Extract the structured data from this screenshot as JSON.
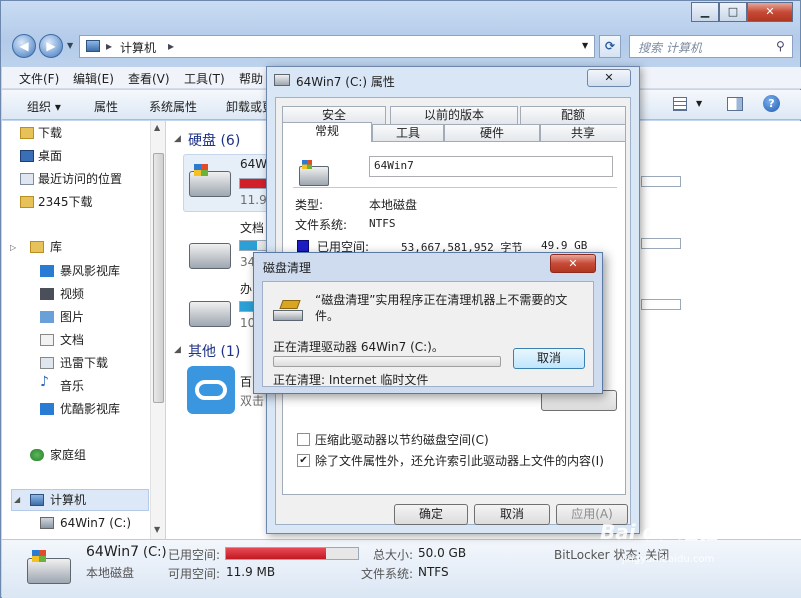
{
  "explorer": {
    "breadcrumb": [
      "计算机"
    ],
    "search_placeholder": "搜索 计算机",
    "menu": [
      "文件(F)",
      "编辑(E)",
      "查看(V)",
      "工具(T)",
      "帮助"
    ],
    "toolbar": [
      "组织 ▾",
      "属性",
      "系统属性",
      "卸载或更"
    ],
    "nav": {
      "favorites": [
        "下载",
        "桌面",
        "最近访问的位置",
        "2345下载"
      ],
      "library_header": "库",
      "libraries": [
        "暴风影视库",
        "视频",
        "图片",
        "文档",
        "迅雷下载",
        "音乐",
        "优酷影视库"
      ],
      "homegroup": "家庭组",
      "computer": "计算机",
      "drive": "64Win7  (C:)"
    },
    "groups": {
      "hdd": "硬盘 (6)",
      "other": "其他 (1)"
    },
    "drives": [
      {
        "name": "64W",
        "sub": "11.9",
        "fill": 0.76,
        "color": "#d2202a"
      },
      {
        "name": "文档",
        "sub": "34",
        "fill": 0.5,
        "color": "#2aa0d6"
      },
      {
        "name": "办",
        "sub": "10",
        "fill": 0.55,
        "color": "#2aa0d6"
      }
    ],
    "other_item": {
      "name": "百",
      "sub": "双击"
    },
    "details": {
      "name": "64Win7",
      "letter": "(C:)",
      "type": "本地磁盘",
      "used_label": "已用空间:",
      "free_label": "可用空间:",
      "free_value": "11.9 MB",
      "used_fill": 0.76,
      "total_label": "总大小:",
      "total_value": "50.0 GB",
      "fs_label": "文件系统:",
      "fs_value": "NTFS",
      "bitlocker": "BitLocker 状态: 关闭"
    }
  },
  "properties": {
    "title": "64Win7 (C:) 属性",
    "tabs_row1": [
      "安全",
      "以前的版本",
      "配额"
    ],
    "tabs_row2": [
      "常规",
      "工具",
      "硬件",
      "共享"
    ],
    "label": "64Win7",
    "type_label": "类型:",
    "type_value": "本地磁盘",
    "fs_label": "文件系统:",
    "fs_value": "NTFS",
    "used_label": "已用空间:",
    "used_value": "53,667,581,952 字节",
    "used_gb": "49.9 GB",
    "compress": "压缩此驱动器以节约磁盘空间(C)",
    "index": "除了文件属性外，还允许索引此驱动器上文件的内容(I)",
    "compress_checked": false,
    "index_checked": true,
    "ok": "确定",
    "cancel": "取消",
    "apply": "应用(A)"
  },
  "cleanup": {
    "title": "磁盘清理",
    "message": "“磁盘清理”实用程序正在清理机器上不需要的文件。",
    "cleaning": "正在清理驱动器 64Win7  (C:)。",
    "cancel": "取消",
    "current": "正在清理: Internet 临时文件",
    "progress": 0
  },
  "watermark": {
    "brand": "Bai du 经验",
    "url": "jingyan.baidu.com"
  }
}
